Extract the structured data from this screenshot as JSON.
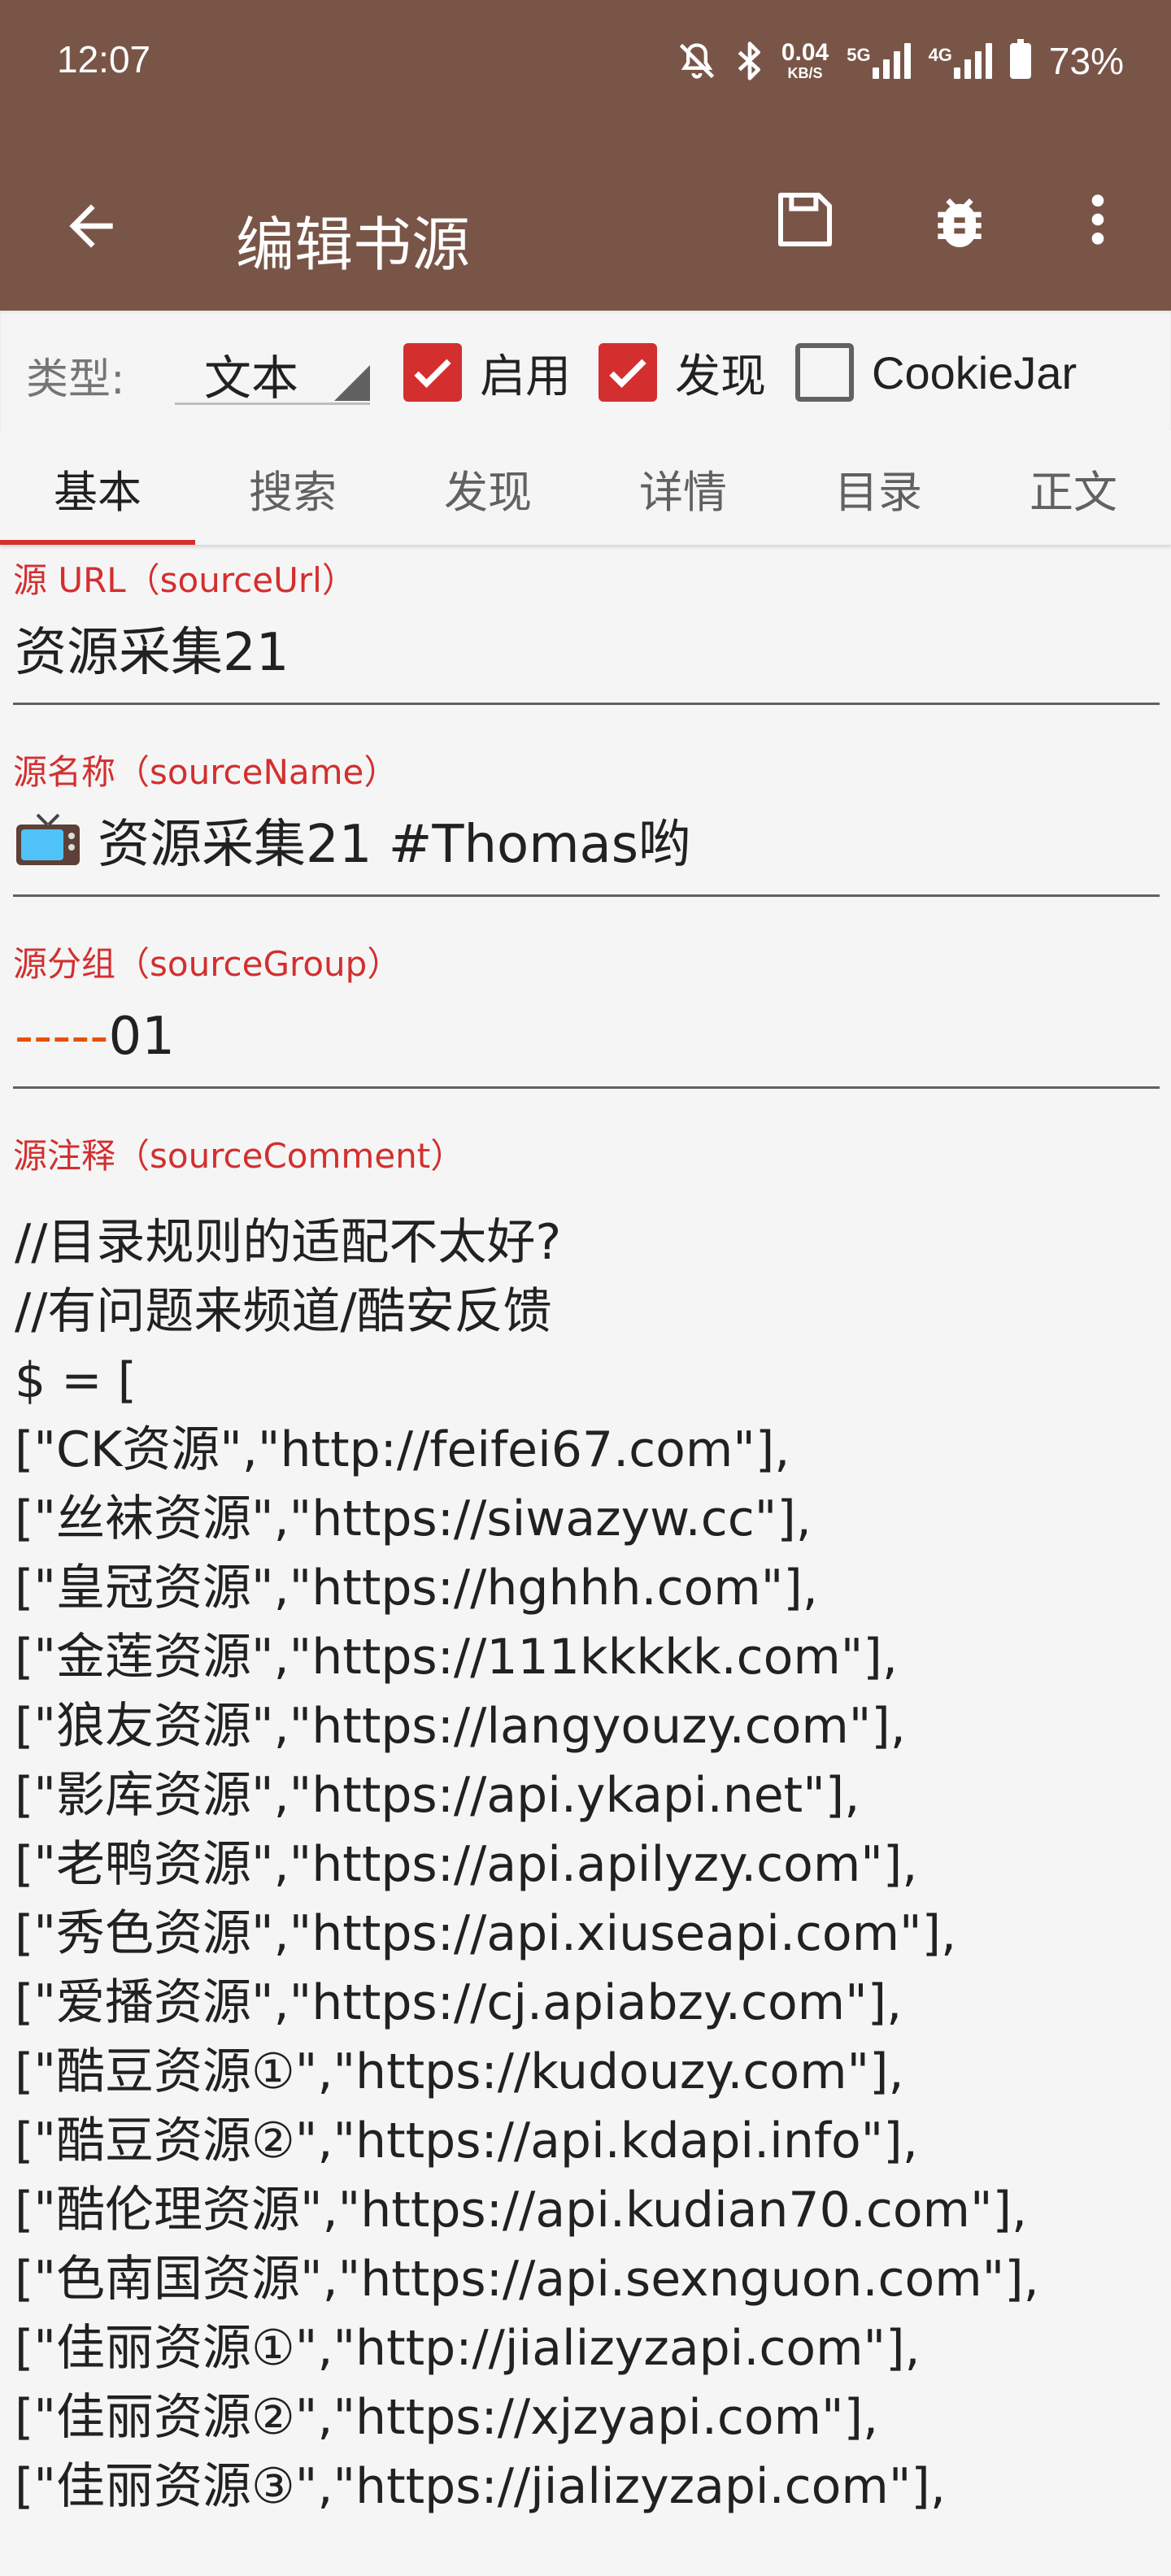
{
  "status_bar": {
    "time": "12:07",
    "net_speed_value": "0.04",
    "net_speed_unit": "KB/S",
    "sig1_label": "5G",
    "sig2_label": "4G",
    "battery": "73%"
  },
  "toolbar": {
    "title": "编辑书源"
  },
  "type_row": {
    "label": "类型:",
    "type_value": "文本",
    "enabled_label": "启用",
    "enabled_checked": true,
    "discover_label": "发现",
    "discover_checked": true,
    "cookiejar_label": "CookieJar",
    "cookiejar_checked": false
  },
  "tabs": [
    {
      "label": "基本",
      "active": true
    },
    {
      "label": "搜索",
      "active": false
    },
    {
      "label": "发现",
      "active": false
    },
    {
      "label": "详情",
      "active": false
    },
    {
      "label": "目录",
      "active": false
    },
    {
      "label": "正文",
      "active": false
    }
  ],
  "fields": {
    "source_url": {
      "label": "源 URL（sourceUrl）",
      "value": "资源采集21"
    },
    "source_name": {
      "label": "源名称（sourceName）",
      "value": "资源采集21 #Thomas哟"
    },
    "source_group": {
      "label": "源分组（sourceGroup）",
      "dash": "-----",
      "value": "01"
    },
    "source_comment": {
      "label": "源注释（sourceComment）"
    }
  },
  "comment_lines": [
    "//目录规则的适配不太好?",
    "//有问题来频道/酷安反馈",
    "$ = [",
    "[\"CK资源\",\"http://feifei67.com\"],",
    "[\"丝袜资源\",\"https://siwazyw.cc\"],",
    "[\"皇冠资源\",\"https://hghhh.com\"],",
    "[\"金莲资源\",\"https://111kkkkk.com\"],",
    "[\"狼友资源\",\"https://langyouzy.com\"],",
    "[\"影库资源\",\"https://api.ykapi.net\"],",
    "[\"老鸭资源\",\"https://api.apilyzy.com\"],",
    "[\"秀色资源\",\"https://api.xiuseapi.com\"],",
    "[\"爱播资源\",\"https://cj.apiabzy.com\"],",
    "[\"酷豆资源①\",\"https://kudouzy.com\"],",
    "[\"酷豆资源②\",\"https://api.kdapi.info\"],",
    "[\"酷伦理资源\",\"https://api.kudian70.com\"],",
    "[\"色南国资源\",\"https://api.sexnguon.com\"],",
    "[\"佳丽资源①\",\"http://jializyzapi.com\"],",
    "[\"佳丽资源②\",\"https://xjzyapi.com\"],",
    "[\"佳丽资源③\",\"https://jializyzapi.com\"],"
  ],
  "colors": {
    "app_bar": "#795548",
    "accent": "#d32f2f",
    "group_dash": "#e65100"
  },
  "icons": [
    "back-arrow-icon",
    "save-icon",
    "bug-icon",
    "more-vert-icon",
    "tv-emoji-icon",
    "dnd-icon",
    "bluetooth-icon",
    "battery-icon"
  ]
}
